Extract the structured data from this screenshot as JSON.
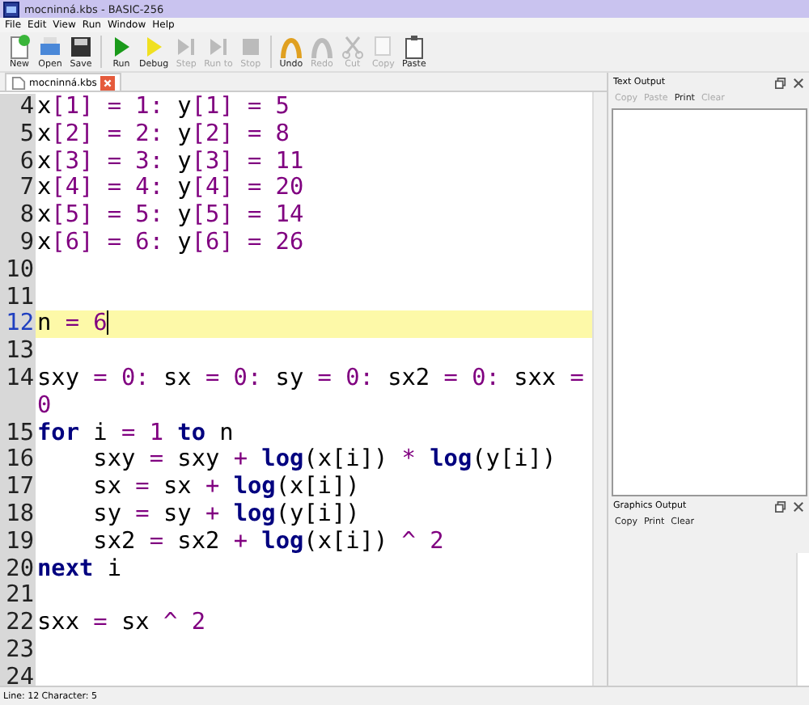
{
  "window": {
    "title": "mocninná.kbs - BASIC-256"
  },
  "menu": [
    "File",
    "Edit",
    "View",
    "Run",
    "Window",
    "Help"
  ],
  "toolbar": [
    {
      "label": "New",
      "disabled": false
    },
    {
      "label": "Open",
      "disabled": false
    },
    {
      "label": "Save",
      "disabled": false
    },
    {
      "label": "Run",
      "disabled": false
    },
    {
      "label": "Debug",
      "disabled": false
    },
    {
      "label": "Step",
      "disabled": true
    },
    {
      "label": "Run to",
      "disabled": true
    },
    {
      "label": "Stop",
      "disabled": true
    },
    {
      "label": "Undo",
      "disabled": false
    },
    {
      "label": "Redo",
      "disabled": true
    },
    {
      "label": "Cut",
      "disabled": true
    },
    {
      "label": "Copy",
      "disabled": true
    },
    {
      "label": "Paste",
      "disabled": false
    }
  ],
  "tab": {
    "label": "mocninná.kbs"
  },
  "editor": {
    "lines": [
      {
        "number": "4",
        "selected": false,
        "tokens": [
          {
            "text": "x",
            "kind": "plain"
          },
          {
            "text": "[1] = 1: ",
            "kind": "op"
          },
          {
            "text": "y",
            "kind": "plain"
          },
          {
            "text": "[1] = 5",
            "kind": "op"
          }
        ]
      },
      {
        "number": "5",
        "selected": false,
        "tokens": [
          {
            "text": "x",
            "kind": "plain"
          },
          {
            "text": "[2] = 2: ",
            "kind": "op"
          },
          {
            "text": "y",
            "kind": "plain"
          },
          {
            "text": "[2] = 8",
            "kind": "op"
          }
        ]
      },
      {
        "number": "6",
        "selected": false,
        "tokens": [
          {
            "text": "x",
            "kind": "plain"
          },
          {
            "text": "[3] = 3: ",
            "kind": "op"
          },
          {
            "text": "y",
            "kind": "plain"
          },
          {
            "text": "[3] = 11",
            "kind": "op"
          }
        ]
      },
      {
        "number": "7",
        "selected": false,
        "tokens": [
          {
            "text": "x",
            "kind": "plain"
          },
          {
            "text": "[4] = 4: ",
            "kind": "op"
          },
          {
            "text": "y",
            "kind": "plain"
          },
          {
            "text": "[4] = 20",
            "kind": "op"
          }
        ]
      },
      {
        "number": "8",
        "selected": false,
        "tokens": [
          {
            "text": "x",
            "kind": "plain"
          },
          {
            "text": "[5] = 5: ",
            "kind": "op"
          },
          {
            "text": "y",
            "kind": "plain"
          },
          {
            "text": "[5] = 14",
            "kind": "op"
          }
        ]
      },
      {
        "number": "9",
        "selected": false,
        "tokens": [
          {
            "text": "x",
            "kind": "plain"
          },
          {
            "text": "[6] = 6: ",
            "kind": "op"
          },
          {
            "text": "y",
            "kind": "plain"
          },
          {
            "text": "[6] = 26",
            "kind": "op"
          }
        ]
      },
      {
        "number": "10",
        "selected": false
      },
      {
        "number": "11",
        "selected": false
      },
      {
        "number": "12",
        "selected": true,
        "tokens": [
          {
            "text": "n",
            "kind": "plain"
          },
          {
            "text": " = 6",
            "kind": "op"
          }
        ]
      },
      {
        "number": "13",
        "selected": false
      },
      {
        "number": "14",
        "selected": false,
        "tokens": [
          {
            "text": "sxy",
            "kind": "plain"
          },
          {
            "text": " = 0: ",
            "kind": "op"
          },
          {
            "text": "sx",
            "kind": "plain"
          },
          {
            "text": " = 0: ",
            "kind": "op"
          },
          {
            "text": "sy",
            "kind": "plain"
          },
          {
            "text": " = 0: ",
            "kind": "op"
          },
          {
            "text": "sx2",
            "kind": "plain"
          },
          {
            "text": " = 0: ",
            "kind": "op"
          },
          {
            "text": "sxx",
            "kind": "plain"
          },
          {
            "text": " = 0",
            "kind": "op"
          }
        ]
      },
      {
        "number": "15",
        "selected": false,
        "tokens": [
          {
            "text": "for",
            "kind": "keyword"
          },
          {
            "text": " i",
            "kind": "plain"
          },
          {
            "text": " = 1 ",
            "kind": "op"
          },
          {
            "text": "to",
            "kind": "keyword"
          },
          {
            "text": " n",
            "kind": "plain"
          }
        ]
      },
      {
        "number": "16",
        "selected": false,
        "tokens": [
          {
            "text": "    sxy",
            "kind": "plain"
          },
          {
            "text": " = ",
            "kind": "op"
          },
          {
            "text": "sxy",
            "kind": "plain"
          },
          {
            "text": " + ",
            "kind": "op"
          },
          {
            "text": "log",
            "kind": "keyword"
          },
          {
            "text": "(x[i])",
            "kind": "plain"
          },
          {
            "text": " * ",
            "kind": "op"
          },
          {
            "text": "log",
            "kind": "keyword"
          },
          {
            "text": "(y[i])",
            "kind": "plain"
          }
        ]
      },
      {
        "number": "17",
        "selected": false,
        "tokens": [
          {
            "text": "    sx",
            "kind": "plain"
          },
          {
            "text": " = ",
            "kind": "op"
          },
          {
            "text": "sx",
            "kind": "plain"
          },
          {
            "text": " + ",
            "kind": "op"
          },
          {
            "text": "log",
            "kind": "keyword"
          },
          {
            "text": "(x[i])",
            "kind": "plain"
          }
        ]
      },
      {
        "number": "18",
        "selected": false,
        "tokens": [
          {
            "text": "    sy",
            "kind": "plain"
          },
          {
            "text": " = ",
            "kind": "op"
          },
          {
            "text": "sy",
            "kind": "plain"
          },
          {
            "text": " + ",
            "kind": "op"
          },
          {
            "text": "log",
            "kind": "keyword"
          },
          {
            "text": "(y[i])",
            "kind": "plain"
          }
        ]
      },
      {
        "number": "19",
        "selected": false,
        "tokens": [
          {
            "text": "    sx2",
            "kind": "plain"
          },
          {
            "text": " = ",
            "kind": "op"
          },
          {
            "text": "sx2",
            "kind": "plain"
          },
          {
            "text": " + ",
            "kind": "op"
          },
          {
            "text": "log",
            "kind": "keyword"
          },
          {
            "text": "(x[i])",
            "kind": "plain"
          },
          {
            "text": " ^ 2",
            "kind": "op"
          }
        ]
      },
      {
        "number": "20",
        "selected": false,
        "tokens": [
          {
            "text": "next",
            "kind": "keyword"
          },
          {
            "text": " i",
            "kind": "plain"
          }
        ]
      },
      {
        "number": "21",
        "selected": false
      },
      {
        "number": "22",
        "selected": false,
        "tokens": [
          {
            "text": "sxx",
            "kind": "plain"
          },
          {
            "text": " = ",
            "kind": "op"
          },
          {
            "text": "sx",
            "kind": "plain"
          },
          {
            "text": " ^ 2",
            "kind": "op"
          }
        ]
      },
      {
        "number": "23",
        "selected": false
      },
      {
        "number": "24",
        "selected": false
      }
    ]
  },
  "text_output": {
    "title": "Text Output",
    "actions": [
      {
        "label": "Copy",
        "disabled": true
      },
      {
        "label": "Paste",
        "disabled": true
      },
      {
        "label": "Print",
        "disabled": false
      },
      {
        "label": "Clear",
        "disabled": true
      }
    ]
  },
  "graphics_output": {
    "title": "Graphics Output",
    "actions": [
      {
        "label": "Copy",
        "disabled": false
      },
      {
        "label": "Print",
        "disabled": false
      },
      {
        "label": "Clear",
        "disabled": false
      }
    ]
  },
  "status_bar": "Line: 12 Character: 5"
}
